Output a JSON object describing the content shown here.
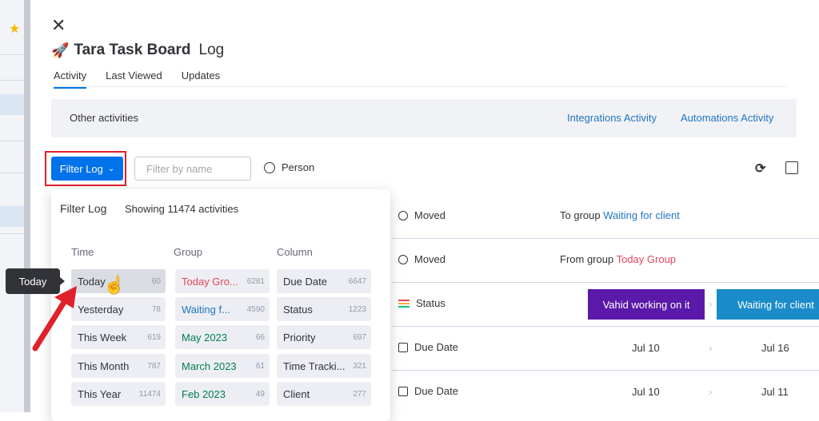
{
  "board": {
    "emoji": "🚀",
    "name": "Tara Task Board",
    "suffix": "Log"
  },
  "tabs": [
    "Activity",
    "Last Viewed",
    "Updates"
  ],
  "other_activities": {
    "label": "Other activities",
    "links": [
      "Integrations Activity",
      "Automations Activity"
    ]
  },
  "toolbar": {
    "filter_label": "Filter Log",
    "filter_placeholder": "Filter by name",
    "person_label": "Person"
  },
  "dropdown": {
    "title": "Filter Log",
    "showing": "Showing 11474 activities",
    "columns": {
      "time": {
        "header": "Time",
        "options": [
          {
            "label": "Today",
            "count": "60"
          },
          {
            "label": "Yesterday",
            "count": "78"
          },
          {
            "label": "This Week",
            "count": "619"
          },
          {
            "label": "This Month",
            "count": "787"
          },
          {
            "label": "This Year",
            "count": "11474"
          }
        ]
      },
      "group": {
        "header": "Group",
        "options": [
          {
            "label": "Today Gro...",
            "count": "6281",
            "color": "#e2445c"
          },
          {
            "label": "Waiting f...",
            "count": "4590",
            "color": "#1f76c2"
          },
          {
            "label": "May 2023",
            "count": "66",
            "color": "#037f4c"
          },
          {
            "label": "March 2023",
            "count": "61",
            "color": "#037f4c"
          },
          {
            "label": "Feb 2023",
            "count": "49",
            "color": "#037f4c"
          }
        ]
      },
      "column": {
        "header": "Column",
        "options": [
          {
            "label": "Due Date",
            "count": "6647"
          },
          {
            "label": "Status",
            "count": "1223"
          },
          {
            "label": "Priority",
            "count": "697"
          },
          {
            "label": "Time Tracki...",
            "count": "321"
          },
          {
            "label": "Client",
            "count": "277"
          }
        ]
      }
    }
  },
  "tooltip": "Today",
  "log_rows": [
    {
      "type": "Moved",
      "detail_prefix": "To group",
      "detail_link": "Waiting for client"
    },
    {
      "type": "Moved",
      "detail_prefix": "From group",
      "detail_link": "Today Group"
    },
    {
      "type": "Status",
      "from": "Vahid working on it",
      "to": "Waiting for client",
      "from_color": "#5a19a8",
      "to_color": "#1a8cc9"
    },
    {
      "type": "Due Date",
      "from": "Jul 10",
      "to": "Jul 16"
    },
    {
      "type": "Due Date",
      "from": "Jul 10",
      "to": "Jul 11"
    }
  ]
}
